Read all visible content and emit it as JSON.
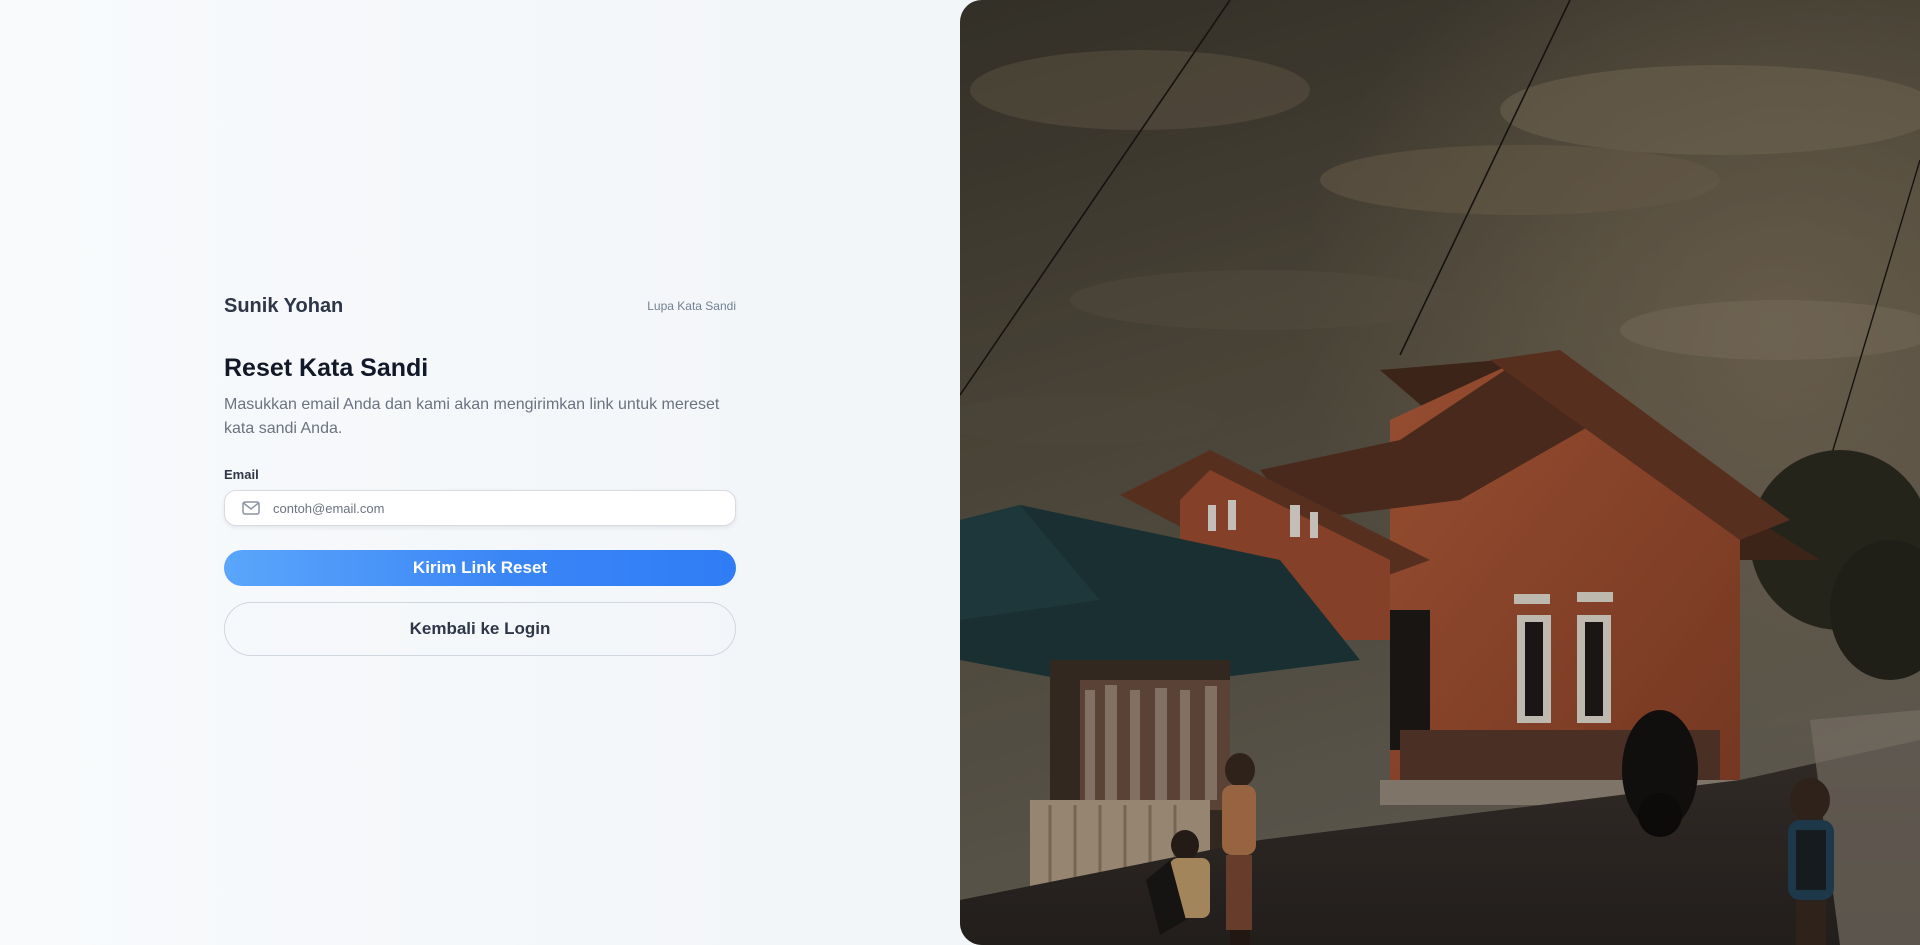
{
  "brand": {
    "name": "Sunik Yohan"
  },
  "header": {
    "crumb": "Lupa Kata Sandi"
  },
  "form": {
    "title": "Reset Kata Sandi",
    "description": "Masukkan email Anda dan kami akan mengirimkan link untuk mereset kata sandi Anda.",
    "email_label": "Email",
    "email_placeholder": "contoh@email.com",
    "email_value": "",
    "email_icon": "mail-icon",
    "submit_label": "Kirim Link Reset",
    "back_label": "Kembali ke Login"
  },
  "colors": {
    "primary": "#3b86f6",
    "heading": "#111827",
    "text_muted": "#6b7280"
  }
}
